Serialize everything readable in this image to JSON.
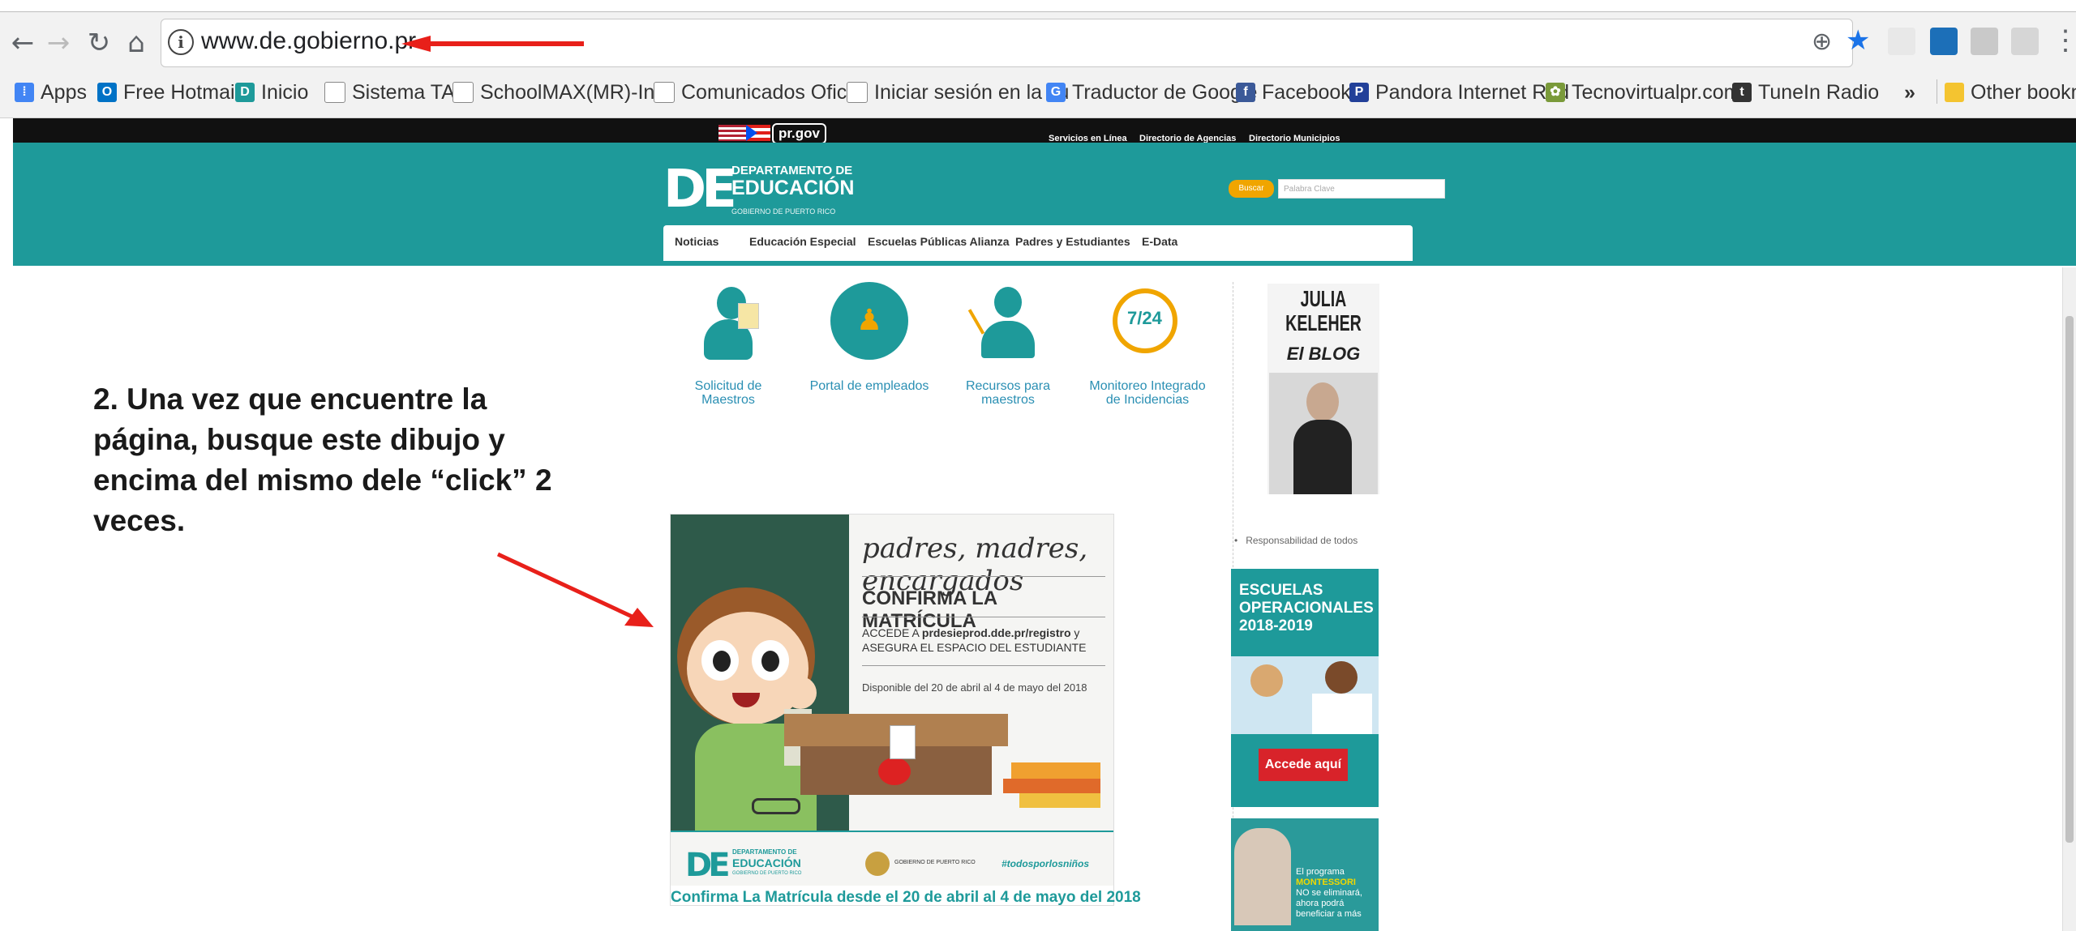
{
  "browser": {
    "url": "www.de.gobierno.pr",
    "bookmarks": [
      "Apps",
      "Free Hotmail",
      "Inicio",
      "Sistema TAL",
      "SchoolMAX(MR)-Inici",
      "Comunicados Oficial",
      "Iniciar sesión en la cu",
      "Traductor de Google",
      "Facebook",
      "Pandora Internet Rad",
      "Tecnovirtualpr.com",
      "TuneIn Radio"
    ],
    "overflow": "»",
    "other_bookmarks": "Other bookmarks"
  },
  "site": {
    "prgov": "pr.gov",
    "top_links": [
      "Servicios en Línea",
      "Directorio de Agencias",
      "Directorio Municipios"
    ],
    "logo_line1": "DEPARTAMENTO DE",
    "logo_line2": "EDUCACIÓN",
    "logo_line3": "GOBIERNO DE PUERTO RICO",
    "search_button": "Buscar",
    "search_placeholder": "Palabra Clave",
    "nav": [
      "Noticias",
      "Educación Especial",
      "Escuelas Públicas Alianza",
      "Padres y Estudiantes",
      "E-Data"
    ],
    "services": [
      {
        "l1": "Solicitud de",
        "l2": "Maestros"
      },
      {
        "l1": "Portal de empleados",
        "l2": ""
      },
      {
        "l1": "Recursos para",
        "l2": "maestros"
      },
      {
        "l1": "Monitoreo Integrado",
        "l2": "de Incidencias"
      }
    ],
    "service_badge": "7/24",
    "blog_name": "JULIA KELEHER",
    "blog_label": "El BLOG",
    "bullet": "Responsabilidad de todos",
    "escuelas": [
      "ESCUELAS",
      "OPERACIONALES",
      "2018-2019"
    ],
    "accede": "Accede aquí",
    "montessori": [
      "El programa",
      "MONTESSORI",
      "NO se eliminará,",
      "ahora podrá",
      "beneficiar a más"
    ]
  },
  "poster": {
    "heading": "padres, madres, encargados",
    "title": "CONFIRMA LA MATRÍCULA",
    "line1a": "ACCEDE A ",
    "line1b": "prdesieprod.dde.pr/registro",
    "line1c": " y",
    "line2": "ASEGURA EL ESPACIO DEL ESTUDIANTE",
    "dates": "Disponible del 20 de abril al 4 de mayo del 2018",
    "gov": "GOBIERNO DE PUERTO RICO",
    "hashtag": "#todosporlosniños",
    "caption": "Confirma La Matrícula desde el 20 de abril al 4 de mayo del 2018"
  },
  "instruction": "2.  Una vez que encuentre la página, busque este dibujo y encima del mismo dele “click” 2 veces.",
  "colors": {
    "teal": "#1e9a9a",
    "arrow": "#e8201a",
    "orange": "#f0a500"
  }
}
